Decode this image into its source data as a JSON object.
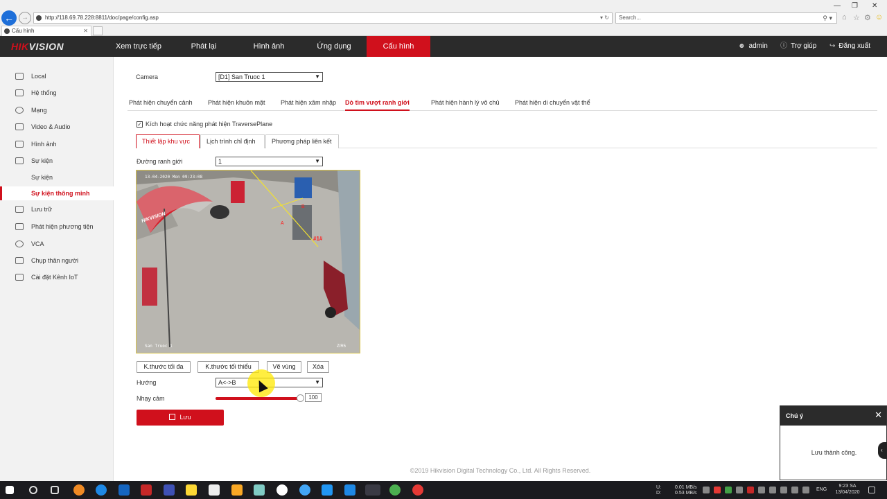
{
  "browser": {
    "url": "http://118.69.78.228:8811/doc/page/config.asp",
    "url_host": "118.69.78.228",
    "search_placeholder": "Search...",
    "tab_title": "Cấu hình"
  },
  "header": {
    "logo_red": "HIK",
    "logo_white": "VISION",
    "nav": [
      "Xem trực tiếp",
      "Phát lại",
      "Hình ảnh",
      "Ứng dụng",
      "Cấu hình"
    ],
    "active_nav": "Cấu hình",
    "user": "admin",
    "help": "Trợ giúp",
    "logout": "Đăng xuất"
  },
  "sidebar": {
    "items": [
      {
        "label": "Local",
        "icon": "monitor-icon"
      },
      {
        "label": "Hệ thống",
        "icon": "system-icon"
      },
      {
        "label": "Mạng",
        "icon": "network-icon"
      },
      {
        "label": "Video & Audio",
        "icon": "video-audio-icon"
      },
      {
        "label": "Hình ảnh",
        "icon": "image-icon"
      },
      {
        "label": "Sự kiện",
        "icon": "calendar-icon"
      },
      {
        "label": "Sự kiện",
        "icon": ""
      },
      {
        "label": "Sự kiện thông minh",
        "icon": ""
      },
      {
        "label": "Lưu trữ",
        "icon": "storage-icon"
      },
      {
        "label": "Phát hiện phương tiện",
        "icon": "vehicle-icon"
      },
      {
        "label": "VCA",
        "icon": "vca-icon"
      },
      {
        "label": "Chụp thân người",
        "icon": "body-capture-icon"
      },
      {
        "label": "Cài đặt Kênh IoT",
        "icon": "iot-icon"
      }
    ],
    "active_item": "Sự kiện thông minh"
  },
  "main": {
    "camera_label": "Camera",
    "camera_value": "[D1] San Truoc 1",
    "tabs": [
      "Phát hiện chuyển cảnh",
      "Phát hiện khuôn mặt",
      "Phát hiện xâm nhập",
      "Dò tìm vượt ranh giới",
      "Phát hiện hành lý vô chủ",
      "Phát hiện di chuyển vật thể"
    ],
    "active_tab": "Dò tìm vượt ranh giới",
    "enable_label": "Kích hoạt chức năng phát hiện TraversePlane",
    "enable_checked": true,
    "subtabs": [
      "Thiết lập khu vực",
      "Lịch trình chỉ định",
      "Phương pháp liên kết"
    ],
    "active_subtab": "Thiết lập khu vực",
    "line_label": "Đường ranh giới",
    "line_value": "1",
    "video": {
      "timestamp": "13-04-2020 Mon 09:23:08",
      "camera_name": "San Truoc 1",
      "channel_code": "Z/R5",
      "umbrella_text": "HIKVISION",
      "line_label_a": "A",
      "line_label_b": "B",
      "line_id": "#1#"
    },
    "buttons": {
      "max_size": "K.thước tối đa",
      "min_size": "K.thước tối thiểu",
      "draw": "Vẽ vùng",
      "clear": "Xóa"
    },
    "direction_label": "Hướng",
    "direction_value": "A<->B",
    "sensitivity_label": "Nhạy cảm",
    "sensitivity_value": "100",
    "sensitivity_pct": 100,
    "save_label": "Lưu",
    "footer": "©2019 Hikvision Digital Technology Co., Ltd. All Rights Reserved."
  },
  "notice": {
    "title": "Chú ý",
    "message": "Lưu thành công."
  },
  "taskbar": {
    "net_up_label": "U:",
    "net_down_label": "D:",
    "net_up": "0.01 MB/s",
    "net_down": "0.53 MB/s",
    "lang": "ENG",
    "time": "9:23 SA",
    "date": "13/04/2020"
  },
  "colors": {
    "accent": "#d0101c",
    "header_bg": "#2b2b2b",
    "sidebar_bg": "#f2f2f2"
  }
}
